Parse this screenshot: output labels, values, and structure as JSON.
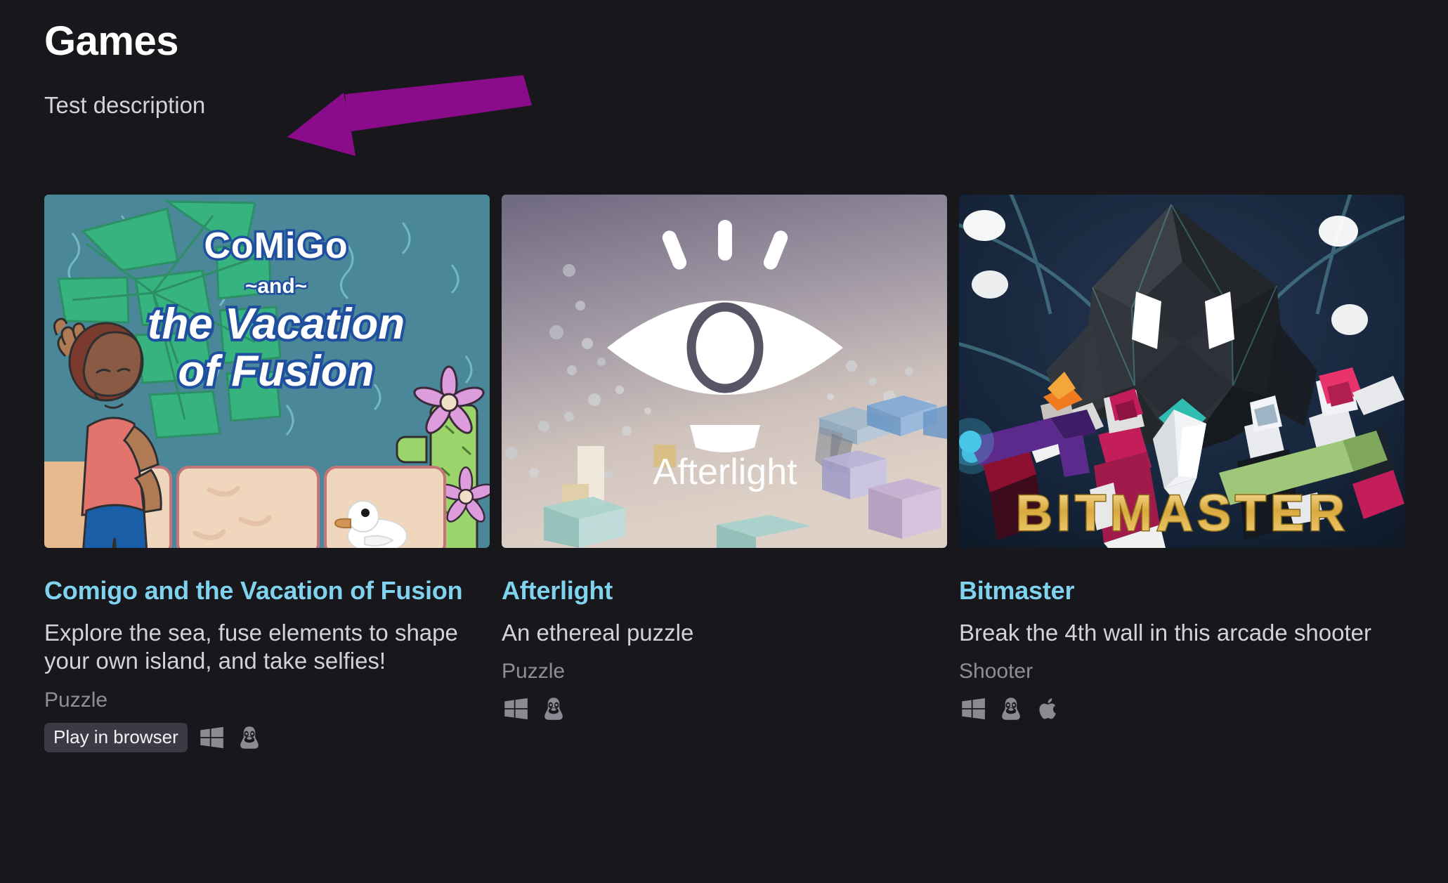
{
  "header": {
    "title": "Games",
    "description": "Test description"
  },
  "annotation": {
    "type": "arrow",
    "direction": "left",
    "color": "#8B0C8B"
  },
  "theme": {
    "background": "#17171c",
    "title_color": "#ffffff",
    "body_text_color": "#d3d3d7",
    "link_color": "#7fd3ef",
    "muted_text_color": "#8e8e96",
    "badge_background": "#3b3b46",
    "platform_icon_color": "#8a8a92"
  },
  "games": [
    {
      "title": "Comigo and the Vacation of Fusion",
      "description": "Explore the sea, fuse elements to shape your own island, and take selfies!",
      "genre": "Puzzle",
      "play_label": "Play in browser",
      "has_play_badge": true,
      "platforms": [
        "windows-icon",
        "linux-icon"
      ],
      "thumbnail": {
        "cover_text_line1": "CoMiGo",
        "cover_text_line2": "~and~",
        "cover_text_line3": "the Vacation",
        "cover_text_line4": "of Fusion"
      }
    },
    {
      "title": "Afterlight",
      "description": "An ethereal puzzle",
      "genre": "Puzzle",
      "play_label": "",
      "has_play_badge": false,
      "platforms": [
        "windows-icon",
        "linux-icon"
      ],
      "thumbnail": {
        "cover_text_line1": "Afterlight"
      }
    },
    {
      "title": "Bitmaster",
      "description": "Break the 4th wall in this arcade shooter",
      "genre": "Shooter",
      "play_label": "",
      "has_play_badge": false,
      "platforms": [
        "windows-icon",
        "linux-icon",
        "apple-icon"
      ],
      "thumbnail": {
        "cover_text_line1": "BITMASTER"
      }
    }
  ]
}
